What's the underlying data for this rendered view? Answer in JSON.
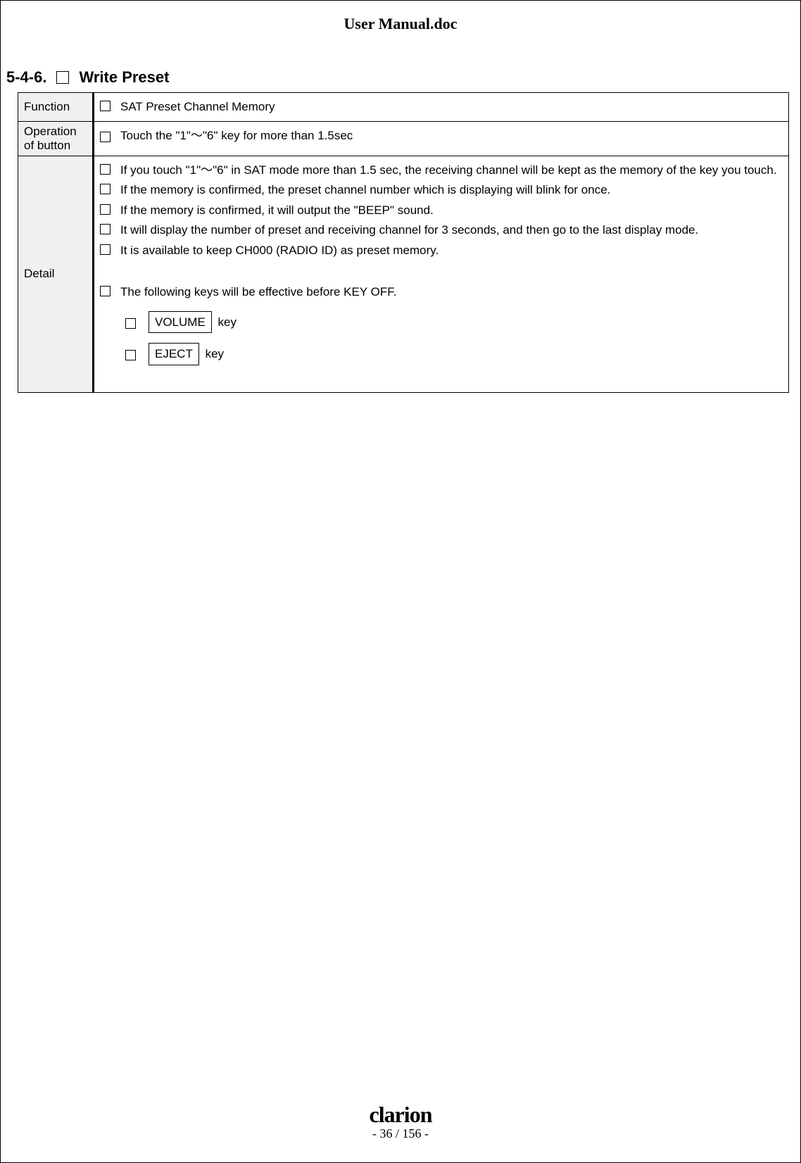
{
  "doc_title": "User Manual.doc",
  "section": {
    "number": "5-4-6.",
    "title": "Write Preset"
  },
  "rows": {
    "function": {
      "label": "Function",
      "text": "SAT Preset Channel Memory"
    },
    "operation": {
      "label_line1": "Operation",
      "label_line2": "of button",
      "text": "Touch the \"1\"～\"6\" key for more than 1.5sec"
    },
    "detail": {
      "label": "Detail",
      "bullets": [
        "If you touch \"1\"～\"6\" in SAT mode more than 1.5 sec, the receiving channel will be kept as the memory of the key you touch.",
        "If the memory is confirmed, the preset channel number which is displaying will blink for once.",
        "If the memory is confirmed, it will output the \"BEEP\" sound.",
        "It will display the number of preset and receiving channel for 3 seconds, and then go to the last display mode.",
        "It is available to keep CH000 (RADIO ID) as preset memory."
      ],
      "footer_bullet": "The following keys will be effective before KEY OFF.",
      "keys": [
        {
          "cap": "VOLUME",
          "suffix": "key"
        },
        {
          "cap": "EJECT",
          "suffix": "key"
        }
      ]
    }
  },
  "footer": {
    "brand": "clarion",
    "page": "- 36 / 156 -"
  }
}
